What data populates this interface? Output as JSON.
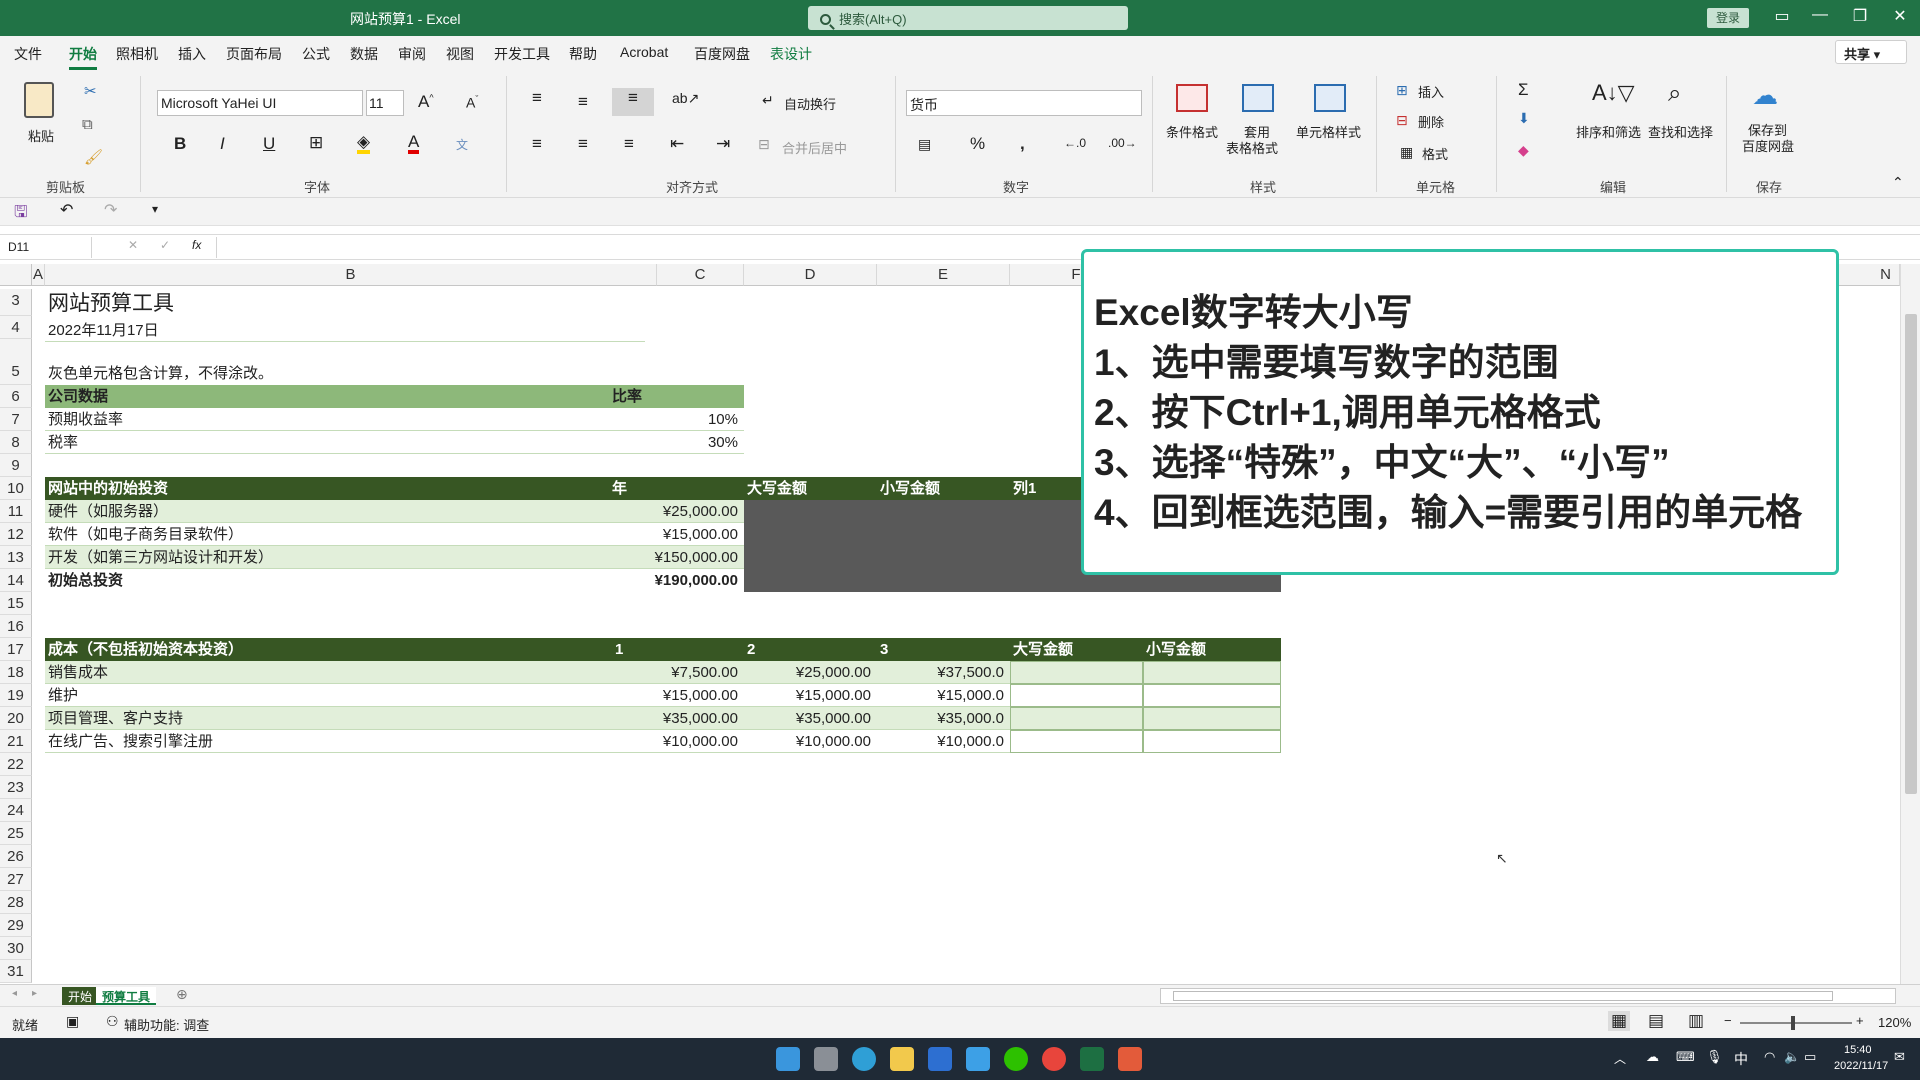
{
  "titlebar": {
    "doc_title": "网站预算1  -  Excel",
    "search_placeholder": "搜索(Alt+Q)",
    "login_label": "登录"
  },
  "menu": {
    "tabs": [
      "文件",
      "开始",
      "照相机",
      "插入",
      "页面布局",
      "公式",
      "数据",
      "审阅",
      "视图",
      "开发工具",
      "帮助",
      "Acrobat",
      "百度网盘",
      "表设计"
    ],
    "active": "开始",
    "share_label": "共享"
  },
  "ribbon": {
    "clipboard": {
      "paste": "粘贴",
      "group": "剪贴板"
    },
    "font": {
      "name": "Microsoft YaHei UI",
      "size": "11",
      "group": "字体"
    },
    "alignment": {
      "wrap": "自动换行",
      "merge": "合并后居中",
      "group": "对齐方式"
    },
    "number": {
      "format": "货币",
      "group": "数字"
    },
    "styles": {
      "conditional": "条件格式",
      "table_fmt_1": "套用",
      "table_fmt_2": "表格格式",
      "cell_styles": "单元格样式",
      "group": "样式"
    },
    "cells": {
      "insert": "插入",
      "delete": "删除",
      "format": "格式",
      "group": "单元格"
    },
    "editing": {
      "sort": "排序和筛选",
      "find": "查找和选择",
      "group": "编辑"
    },
    "save": {
      "save_1": "保存到",
      "save_2": "百度网盘",
      "group": "保存"
    }
  },
  "formula_bar": {
    "name_box": "D11",
    "fx": "fx"
  },
  "columns": [
    "A",
    "B",
    "C",
    "D",
    "E",
    "F",
    "N"
  ],
  "rows": [
    "3",
    "4",
    "5",
    "6",
    "7",
    "8",
    "9",
    "10",
    "11",
    "12",
    "13",
    "14",
    "15",
    "16",
    "17",
    "18",
    "19",
    "20",
    "21",
    "22",
    "23",
    "24",
    "25",
    "26",
    "27",
    "28",
    "29",
    "30",
    "31"
  ],
  "sheet": {
    "title": "网站预算工具",
    "date": "2022年11月17日",
    "note": "灰色单元格包含计算，不得涂改。",
    "company": {
      "header": "公司数据",
      "rate_header": "比率",
      "rows": [
        [
          "预期收益率",
          "10%"
        ],
        [
          "税率",
          "30%"
        ]
      ]
    },
    "initial": {
      "headers": [
        "网站中的初始投资",
        "年",
        "大写金额",
        "小写金额",
        "列1"
      ],
      "rows": [
        [
          "硬件（如服务器）",
          "¥25,000.00"
        ],
        [
          "软件（如电子商务目录软件）",
          "¥15,000.00"
        ],
        [
          "开发（如第三方网站设计和开发）",
          "¥150,000.00"
        ]
      ],
      "total": [
        "初始总投资",
        "¥190,000.00"
      ]
    },
    "cost": {
      "headers": [
        "成本（不包括初始资本投资）",
        "1",
        "2",
        "3",
        "大写金额",
        "小写金额"
      ],
      "rows": [
        [
          "销售成本",
          "¥7,500.00",
          "¥25,000.00",
          "¥37,500.0"
        ],
        [
          "维护",
          "¥15,000.00",
          "¥15,000.00",
          "¥15,000.0"
        ],
        [
          "项目管理、客户支持",
          "¥35,000.00",
          "¥35,000.00",
          "¥35,000.0"
        ],
        [
          "在线广告、搜索引擎注册",
          "¥10,000.00",
          "¥10,000.00",
          "¥10,000.0"
        ]
      ]
    }
  },
  "overlay": {
    "lines": [
      "Excel数字转大小写",
      "1、选中需要填写数字的范围",
      "2、按下Ctrl+1,调用单元格格式",
      "3、选择“特殊”，中文“大”、“小写”",
      "4、回到框选范围，输入=需要引用的单元格"
    ]
  },
  "sheet_tabs": [
    "开始",
    "预算工具"
  ],
  "status": {
    "ready": "就绪",
    "accessibility": "辅助功能: 调查",
    "zoom": "120%"
  },
  "taskbar": {
    "ime": "中",
    "time": "15:40",
    "date": "2022/11/17"
  },
  "colors": {
    "excel_green": "#217346",
    "header_dark": "#375623",
    "light_green": "#e2efda",
    "gray_calc": "#595959",
    "overlay_border": "#2fc1a6"
  }
}
